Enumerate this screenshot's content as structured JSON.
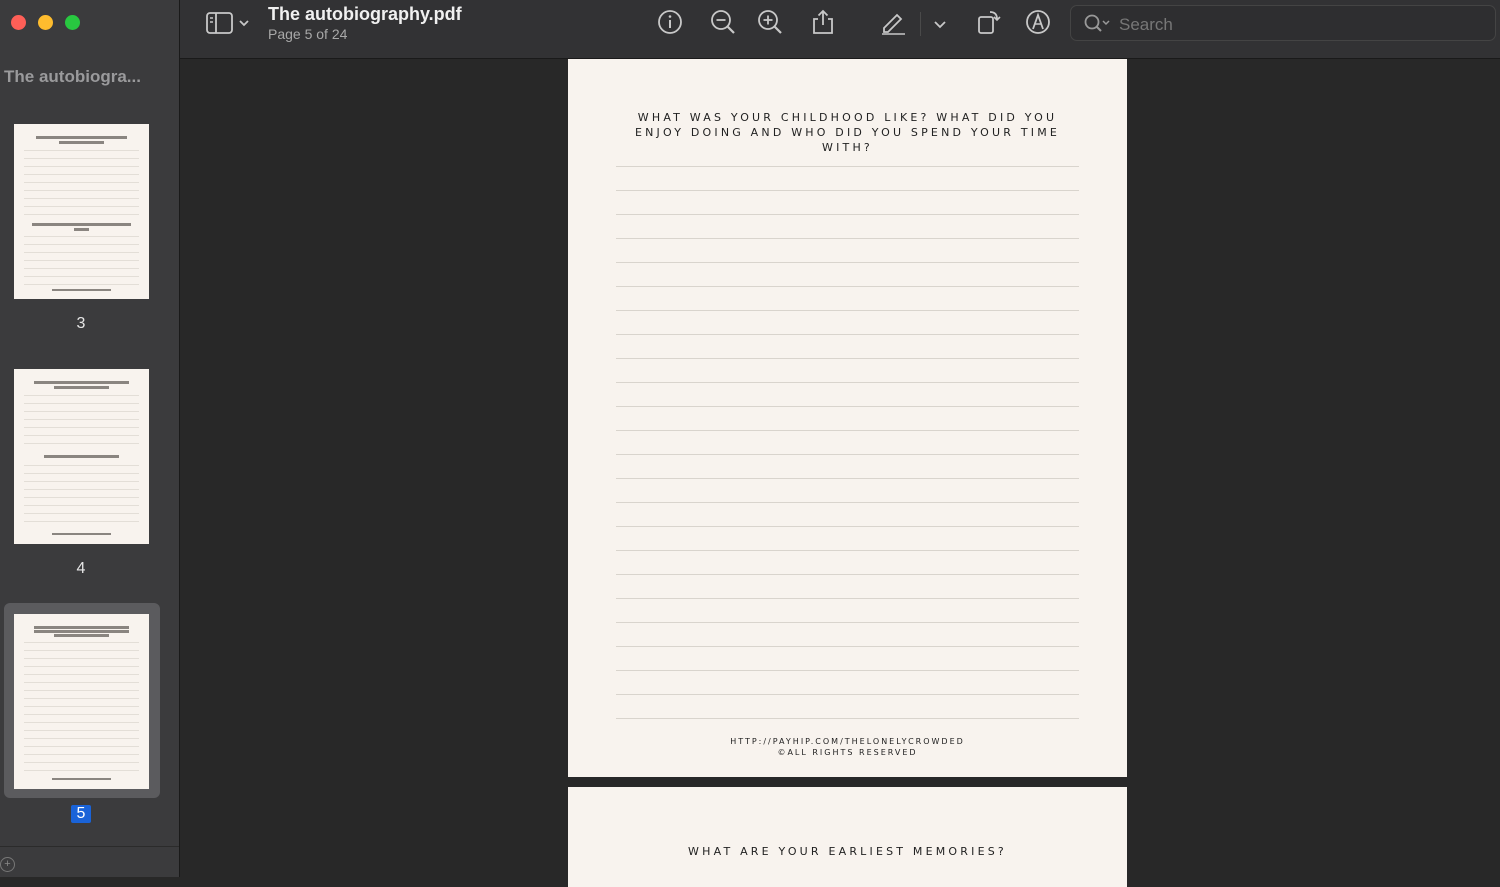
{
  "window": {
    "document_title": "The autobiography.pdf",
    "page_indicator": "Page 5 of 24"
  },
  "sidebar": {
    "title": "The autobiogra...",
    "thumbnails": [
      {
        "page": "3",
        "selected": false
      },
      {
        "page": "4",
        "selected": false
      },
      {
        "page": "5",
        "selected": true
      }
    ]
  },
  "toolbar": {
    "icons": [
      "sidebar-toggle-icon",
      "info-icon",
      "zoom-out-icon",
      "zoom-in-icon",
      "share-icon",
      "markup-pen-icon",
      "chevron-down-icon",
      "rotate-icon",
      "annotate-icon"
    ],
    "search_placeholder": "Search"
  },
  "page5": {
    "heading": "WHAT WAS YOUR CHILDHOOD LIKE? WHAT DID YOU ENJOY DOING AND WHO DID YOU SPEND YOUR TIME WITH?",
    "footer_url": "HTTP://PAYHIP.COM/THELONELYCROWDED",
    "footer_rights": "©ALL RIGHTS RESERVED"
  },
  "page6": {
    "heading": "WHAT ARE YOUR EARLIEST MEMORIES?"
  }
}
